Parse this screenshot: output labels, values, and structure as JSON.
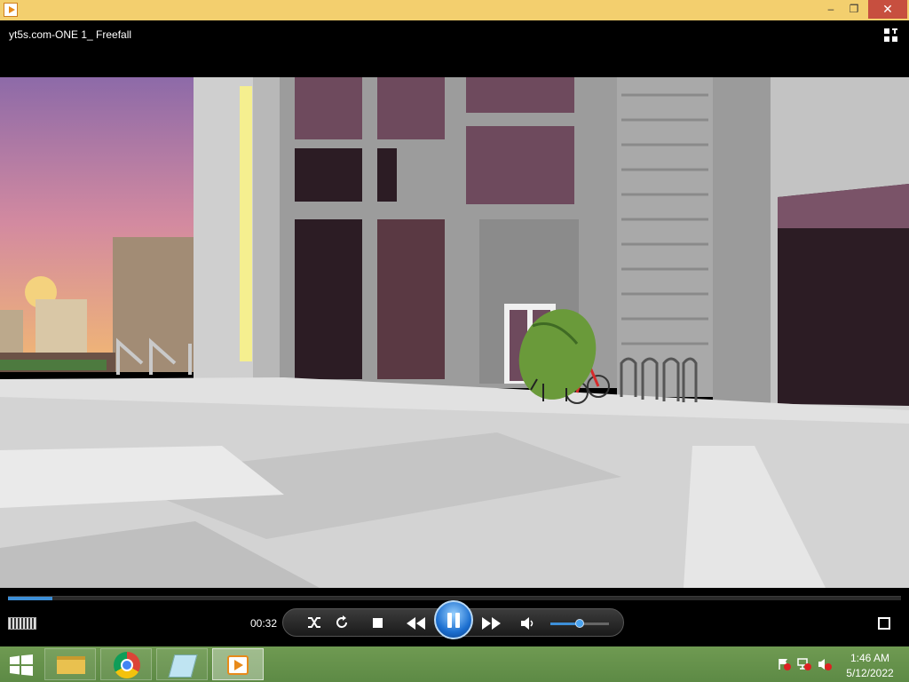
{
  "window": {
    "title_bar_color": "#f3cf6e",
    "controls": {
      "minimize": "–",
      "maximize": "❐",
      "close": "✕"
    }
  },
  "header": {
    "media_title": "yt5s.com-ONE 1_ Freefall"
  },
  "player": {
    "elapsed": "00:32",
    "progress_fraction": 0.05,
    "volume_fraction": 0.5,
    "accent": "#3d8fd8",
    "controls": [
      "shuffle-icon",
      "repeat-icon",
      "stop-icon",
      "previous-icon",
      "pause-icon",
      "next-icon",
      "volume-icon"
    ]
  },
  "taskbar": {
    "items": [
      "file-explorer-icon",
      "chrome-icon",
      "notepad-icon",
      "media-player-icon"
    ],
    "tray": [
      "action-center-icon",
      "network-icon",
      "volume-muted-icon"
    ],
    "time": "1:46 AM",
    "date": "5/12/2022"
  }
}
